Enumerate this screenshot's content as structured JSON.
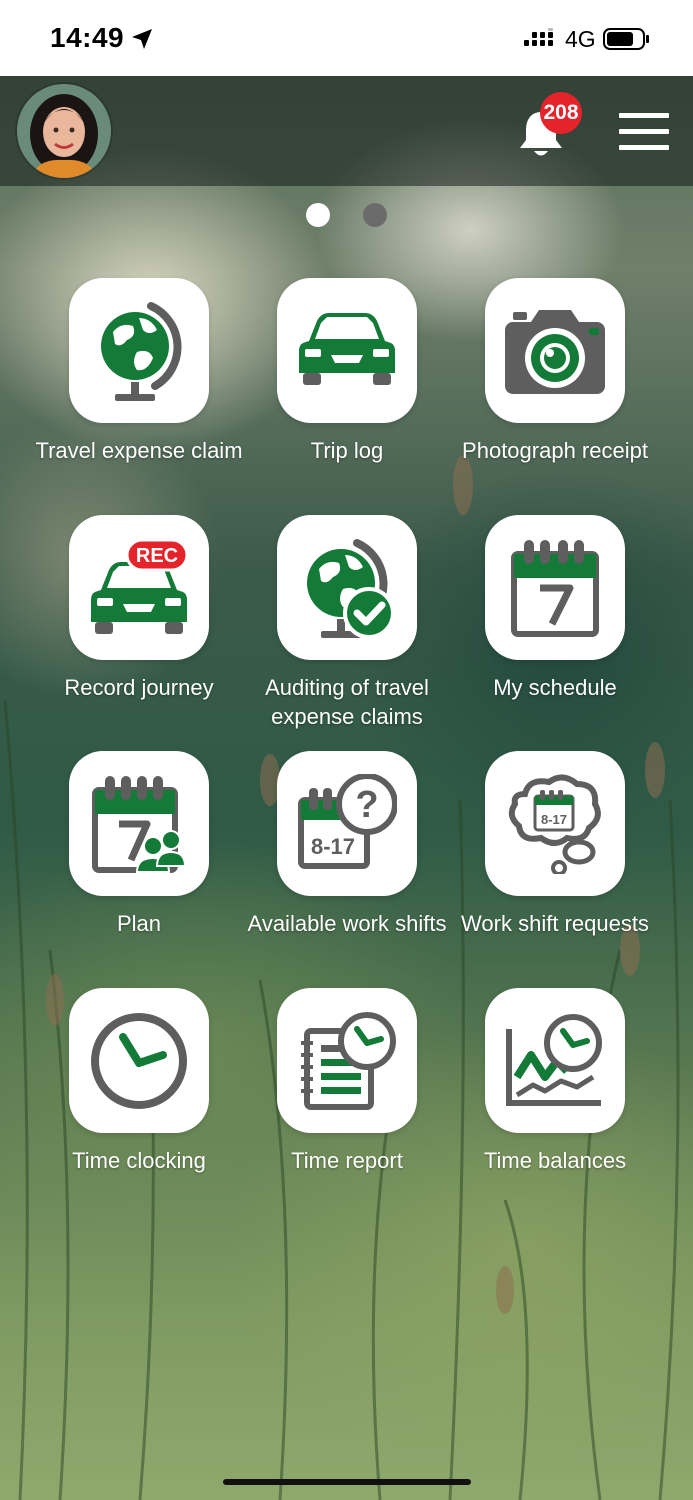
{
  "status_bar": {
    "time": "14:49",
    "network": "4G"
  },
  "header": {
    "notification_count": "208"
  },
  "pager": {
    "active_index": 0,
    "count": 2
  },
  "tiles": [
    {
      "label": "Travel expense claim",
      "icon": "globe-icon"
    },
    {
      "label": "Trip log",
      "icon": "car-icon"
    },
    {
      "label": "Photograph receipt",
      "icon": "camera-icon"
    },
    {
      "label": "Record journey",
      "icon": "car-rec-icon"
    },
    {
      "label": "Auditing of travel expense claims",
      "icon": "globe-check-icon"
    },
    {
      "label": "My schedule",
      "icon": "calendar-icon"
    },
    {
      "label": "Plan",
      "icon": "calendar-group-icon"
    },
    {
      "label": "Available work shifts",
      "icon": "calendar-question-icon"
    },
    {
      "label": "Work shift requests",
      "icon": "calendar-thought-icon"
    },
    {
      "label": "Time clocking",
      "icon": "clock-icon"
    },
    {
      "label": "Time report",
      "icon": "notebook-clock-icon"
    },
    {
      "label": "Time balances",
      "icon": "chart-clock-icon"
    }
  ],
  "colors": {
    "icon_green": "#137a38",
    "icon_gray": "#5e5e5e",
    "badge_red": "#e5232a"
  }
}
